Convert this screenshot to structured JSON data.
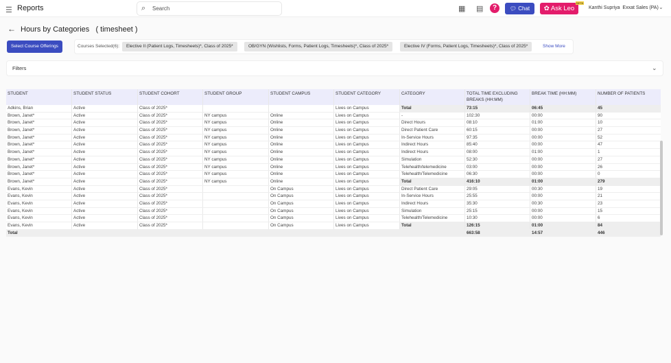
{
  "header": {
    "app_title": "Reports",
    "search_placeholder": "Search",
    "chat_label": "Chat",
    "ask_leo_label": "Ask Leo",
    "beta_badge": "BETA",
    "help_label": "?",
    "user_name": "Kanthi Supriya",
    "org_name": "Exxat Sales (PA)"
  },
  "page": {
    "title": "Hours by Categories",
    "subtitle": "( timesheet )",
    "select_button": "Select Course Offerings",
    "courses_label": "Courses Selected(6):",
    "courses": [
      "Elective II (Patient Logs, Timesheets)*, Class of 2025*",
      "OB/GYN (Wishlists, Forms, Patient Logs, Timesheets)*, Class of 2025*",
      "Elective IV (Forms, Patient Logs, Timesheets)*, Class of 2025*"
    ],
    "show_more": "Show More",
    "filters_label": "Filters"
  },
  "table": {
    "columns": [
      "STUDENT",
      "STUDENT STATUS",
      "STUDENT COHORT",
      "STUDENT GROUP",
      "STUDENT CAMPUS",
      "STUDENT CATEGORY",
      "CATEGORY",
      "TOTAL TIME EXCLUDING BREAKS (HH:MM)",
      "BREAK TIME (HH:MM)",
      "NUMBER OF PATIENTS"
    ],
    "rows": [
      {
        "total": true,
        "cells": [
          "Adkins, Brian",
          "Active",
          "Class of 2025*",
          "",
          "",
          "Lives on Campus",
          "Total",
          "73:15",
          "06:45",
          "45"
        ]
      },
      {
        "cells": [
          "Brown, Janet*",
          "Active",
          "Class of 2025*",
          "NY campus",
          "Online",
          "Lives on Campus",
          "-",
          "102:30",
          "00:00",
          "90"
        ]
      },
      {
        "cells": [
          "Brown, Janet*",
          "Active",
          "Class of 2025*",
          "NY campus",
          "Online",
          "Lives on Campus",
          "Direct Hours",
          "08:10",
          "01:00",
          "10"
        ]
      },
      {
        "cells": [
          "Brown, Janet*",
          "Active",
          "Class of 2025*",
          "NY campus",
          "Online",
          "Lives on Campus",
          "Direct Patient Care",
          "60:15",
          "00:00",
          "27"
        ]
      },
      {
        "cells": [
          "Brown, Janet*",
          "Active",
          "Class of 2025*",
          "NY campus",
          "Online",
          "Lives on Campus",
          "In-Service Hours",
          "97:35",
          "00:00",
          "52"
        ]
      },
      {
        "cells": [
          "Brown, Janet*",
          "Active",
          "Class of 2025*",
          "NY campus",
          "Online",
          "Lives on Campus",
          "Indirect Hours",
          "85:40",
          "00:00",
          "47"
        ]
      },
      {
        "cells": [
          "Brown, Janet*",
          "Active",
          "Class of 2025*",
          "NY campus",
          "Online",
          "Lives on Campus",
          "Indirect Hours",
          "08:00",
          "01:00",
          "1"
        ]
      },
      {
        "cells": [
          "Brown, Janet*",
          "Active",
          "Class of 2025*",
          "NY campus",
          "Online",
          "Lives on Campus",
          "Simulation",
          "52:30",
          "00:00",
          "27"
        ]
      },
      {
        "cells": [
          "Brown, Janet*",
          "Active",
          "Class of 2025*",
          "NY campus",
          "Online",
          "Lives on Campus",
          "Telehealth/telemedicine",
          "03:00",
          "00:00",
          "26"
        ]
      },
      {
        "cells": [
          "Brown, Janet*",
          "Active",
          "Class of 2025*",
          "NY campus",
          "Online",
          "Lives on Campus",
          "Telehealth/Telemedicine",
          "06:30",
          "00:00",
          "0"
        ]
      },
      {
        "total": true,
        "cells": [
          "Brown, Janet*",
          "Active",
          "Class of 2025*",
          "NY campus",
          "Online",
          "Lives on Campus",
          "Total",
          "416:10",
          "01:00",
          "279"
        ]
      },
      {
        "cells": [
          "Evans, Kevin",
          "Active",
          "Class of 2025*",
          "",
          "On Campus",
          "Lives on Campus",
          "Direct Patient Care",
          "29:05",
          "00:30",
          "19"
        ]
      },
      {
        "cells": [
          "Evans, Kevin",
          "Active",
          "Class of 2025*",
          "",
          "On Campus",
          "Lives on Campus",
          "In-Service Hours",
          "25:55",
          "00:00",
          "21"
        ]
      },
      {
        "cells": [
          "Evans, Kevin",
          "Active",
          "Class of 2025*",
          "",
          "On Campus",
          "Lives on Campus",
          "Indirect Hours",
          "35:30",
          "00:30",
          "23"
        ]
      },
      {
        "cells": [
          "Evans, Kevin",
          "Active",
          "Class of 2025*",
          "",
          "On Campus",
          "Lives on Campus",
          "Simulation",
          "25:15",
          "00:00",
          "15"
        ]
      },
      {
        "cells": [
          "Evans, Kevin",
          "Active",
          "Class of 2025*",
          "",
          "On Campus",
          "Lives on Campus",
          "Telehealth/Telemedicine",
          "10:30",
          "00:00",
          "6"
        ]
      },
      {
        "total": true,
        "cells": [
          "Evans, Kevin",
          "Active",
          "Class of 2025*",
          "",
          "On Campus",
          "Lives on Campus",
          "Total",
          "126:15",
          "01:00",
          "84"
        ]
      }
    ],
    "grand_total": {
      "label": "Total",
      "total_time": "663:58",
      "break_time": "14:57",
      "patients": "446"
    }
  }
}
